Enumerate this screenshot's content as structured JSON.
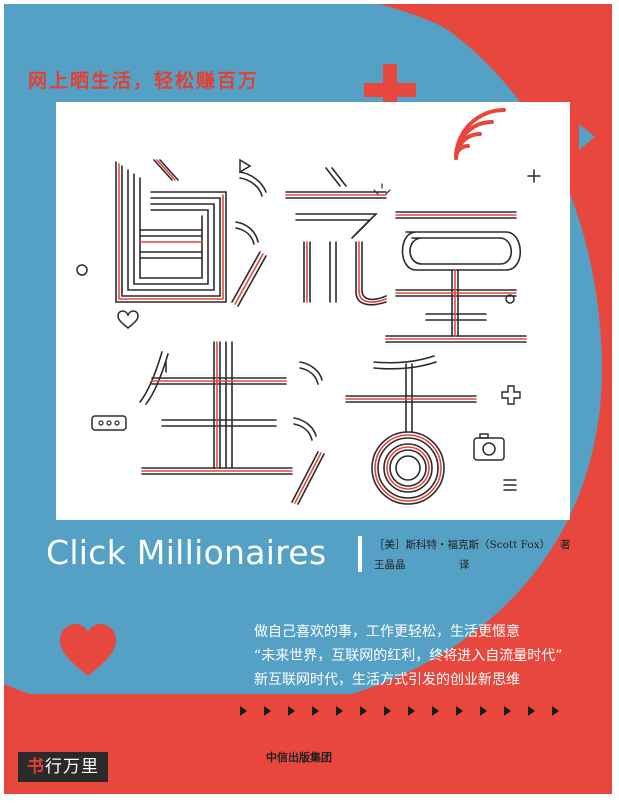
{
  "cover": {
    "tagline": "网上晒生活，轻松赚百万",
    "title_chinese": "自流量生活",
    "title_english": "Click Millionaires",
    "author_line": "［美］斯科特・福克斯（Scott Fox）",
    "author_role": "著",
    "translator_name": "王晶晶",
    "translator_role": "译",
    "blurb": [
      "做自己喜欢的事，工作更轻松，生活更惬意",
      "“未来世界，互联网的红利，终将进入自流量时代”",
      "新互联网时代，生活方式引发的创业新思维"
    ],
    "publisher": "中信出版集团"
  },
  "watermark": {
    "first_char": "书",
    "rest": "行万里"
  },
  "colors": {
    "red": "#e7473c",
    "blue": "#55a1c6",
    "white": "#ffffff",
    "dark": "#2a2a2a"
  },
  "icons": [
    "plus-icon",
    "triangle-right-icon",
    "wifi-signal-icon",
    "heart-icon",
    "camera-icon",
    "dots-ellipsis-icon",
    "sparkle-icon",
    "menu-lines-icon",
    "arrow-triangle-icon"
  ]
}
